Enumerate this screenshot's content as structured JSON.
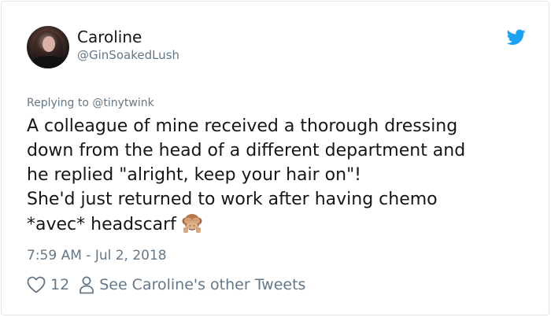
{
  "author": {
    "name": "Caroline",
    "handle": "@GinSoakedLush"
  },
  "reply": {
    "prefix": "Replying to",
    "mention": "@tinytwink"
  },
  "tweet": {
    "lines": [
      "A colleague of mine received a thorough dressing",
      "down from the head of a different department and",
      "he replied \"alright, keep your hair on\"!",
      "She'd just returned to work after having chemo",
      "*avec* headscarf"
    ],
    "emoji": "see-no-evil-monkey-icon"
  },
  "timestamp": "7:59 AM - Jul 2, 2018",
  "actions": {
    "like_count": "12",
    "other_tweets_label": "See Caroline's other Tweets"
  },
  "colors": {
    "text_primary": "#14171a",
    "text_secondary": "#657786",
    "twitter_blue": "#1da1f2",
    "border": "#e1e8ed"
  }
}
